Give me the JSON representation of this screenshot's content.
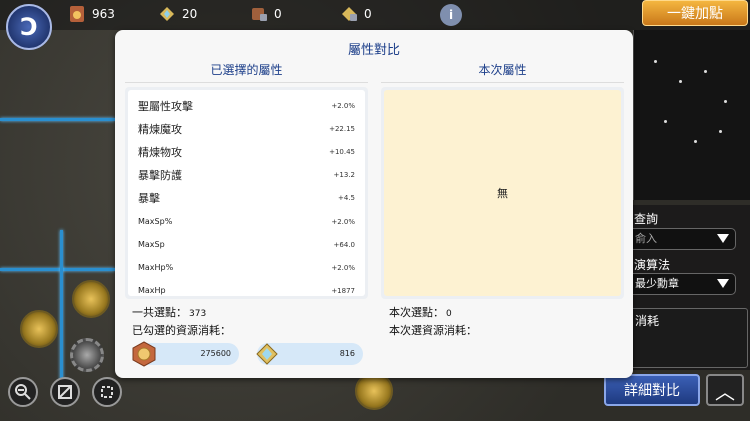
{
  "topbar": {
    "home_icon_glyph": "Ↄ",
    "resources": [
      {
        "icon": "medal-icon",
        "value": "963"
      },
      {
        "icon": "crystal-icon",
        "value": "20"
      },
      {
        "icon": "lock-chest-icon",
        "value": "0"
      },
      {
        "icon": "lock-crystal-icon",
        "value": "0"
      }
    ],
    "info_glyph": "i",
    "add_point_label": "一鍵加點"
  },
  "side_panel": {
    "query_label": "查詢",
    "query_placeholder": "俞入",
    "algorithm_label": "演算法",
    "algorithm_value": "最少勳章",
    "consume_label": "消耗",
    "detail_button": "詳細對比",
    "up_glyph": "︿"
  },
  "dialog": {
    "title": "屬性對比",
    "left_header": "已選擇的屬性",
    "right_header": "本次屬性",
    "attributes": [
      {
        "name": "聖屬性攻擊",
        "value": "+2.0%",
        "small": false
      },
      {
        "name": "精煉魔攻",
        "value": "+22.15",
        "small": false
      },
      {
        "name": "精煉物攻",
        "value": "+10.45",
        "small": false
      },
      {
        "name": "暴擊防護",
        "value": "+13.2",
        "small": false
      },
      {
        "name": "暴擊",
        "value": "+4.5",
        "small": false
      },
      {
        "name": "MaxSp%",
        "value": "+2.0%",
        "small": true
      },
      {
        "name": "MaxSp",
        "value": "+64.0",
        "small": true
      },
      {
        "name": "MaxHp%",
        "value": "+2.0%",
        "small": true
      },
      {
        "name": "MaxHp",
        "value": "+1877",
        "small": true
      }
    ],
    "current_empty": "無",
    "total_points_label": "一共選點：",
    "total_points_value": "373",
    "checked_cost_label": "已勾選的資源消耗：",
    "costs": [
      {
        "icon": "medal-icon",
        "value": "275600"
      },
      {
        "icon": "crystal-icon",
        "value": "816"
      }
    ],
    "current_points_label": "本次選點：",
    "current_points_value": "0",
    "current_cost_label": "本次選資源消耗："
  }
}
